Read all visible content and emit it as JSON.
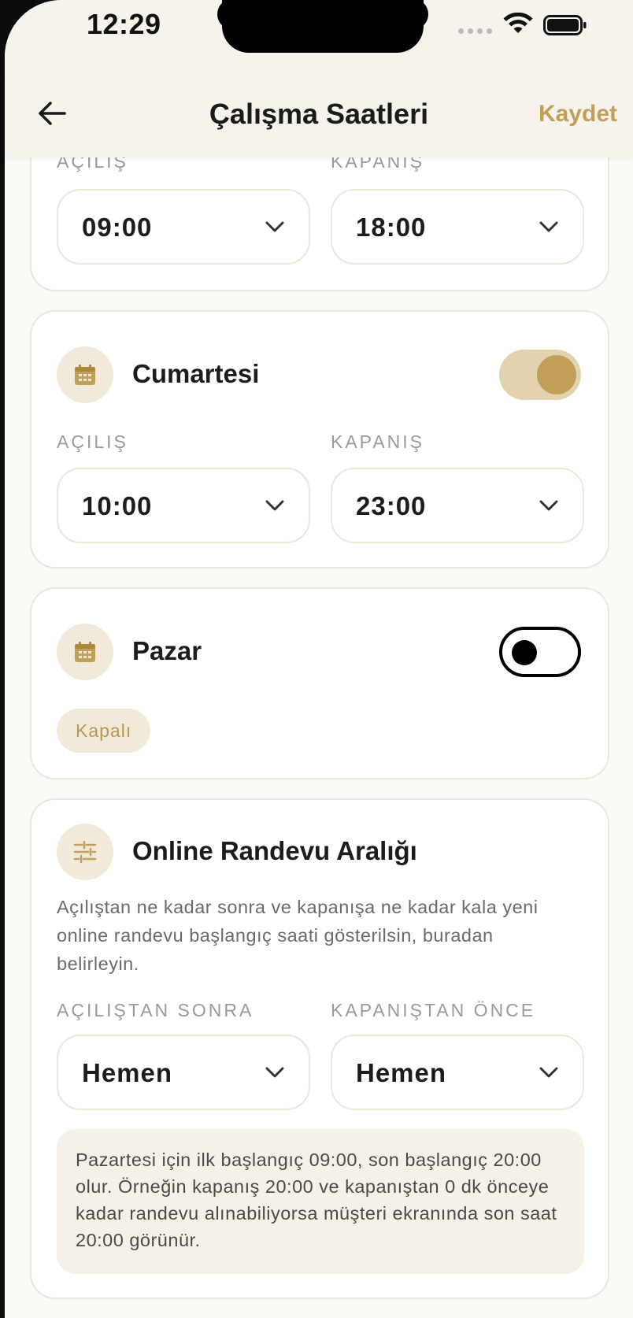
{
  "status_bar": {
    "time": "12:29",
    "icons": [
      "signal-dots-icon",
      "wifi-icon",
      "battery-icon"
    ]
  },
  "nav": {
    "title": "Çalışma Saatleri",
    "save_label": "Kaydet",
    "back_icon": "arrow-left-icon"
  },
  "colors": {
    "accent": "#c19f58",
    "accent_light": "#f1eadb",
    "border": "#ece7d8",
    "background": "#fbfaf7"
  },
  "days": [
    {
      "name": "",
      "open_label": "AÇILIŞ",
      "close_label": "KAPANIŞ",
      "open_time": "09:00",
      "close_time": "18:00"
    },
    {
      "name": "Cumartesi",
      "enabled": true,
      "open_label": "AÇILIŞ",
      "close_label": "KAPANIŞ",
      "open_time": "10:00",
      "close_time": "23:00"
    },
    {
      "name": "Pazar",
      "enabled": false,
      "closed_badge": "Kapalı"
    }
  ],
  "online": {
    "title": "Online Randevu Aralığı",
    "description": "Açılıştan ne kadar sonra ve kapanışa ne kadar kala yeni online randevu başlangıç saati gösterilsin, buradan belirleyin.",
    "after_open_label": "AÇILIŞTAN SONRA",
    "before_close_label": "KAPANIŞTAN ÖNCE",
    "after_open_value": "Hemen",
    "before_close_value": "Hemen",
    "info": "Pazartesi için ilk başlangıç 09:00, son başlangıç 20:00 olur. Örneğin kapanış 20:00 ve kapanıştan 0 dk önceye kadar randevu alınabiliyorsa müşteri ekranında son saat 20:00 görünür."
  }
}
